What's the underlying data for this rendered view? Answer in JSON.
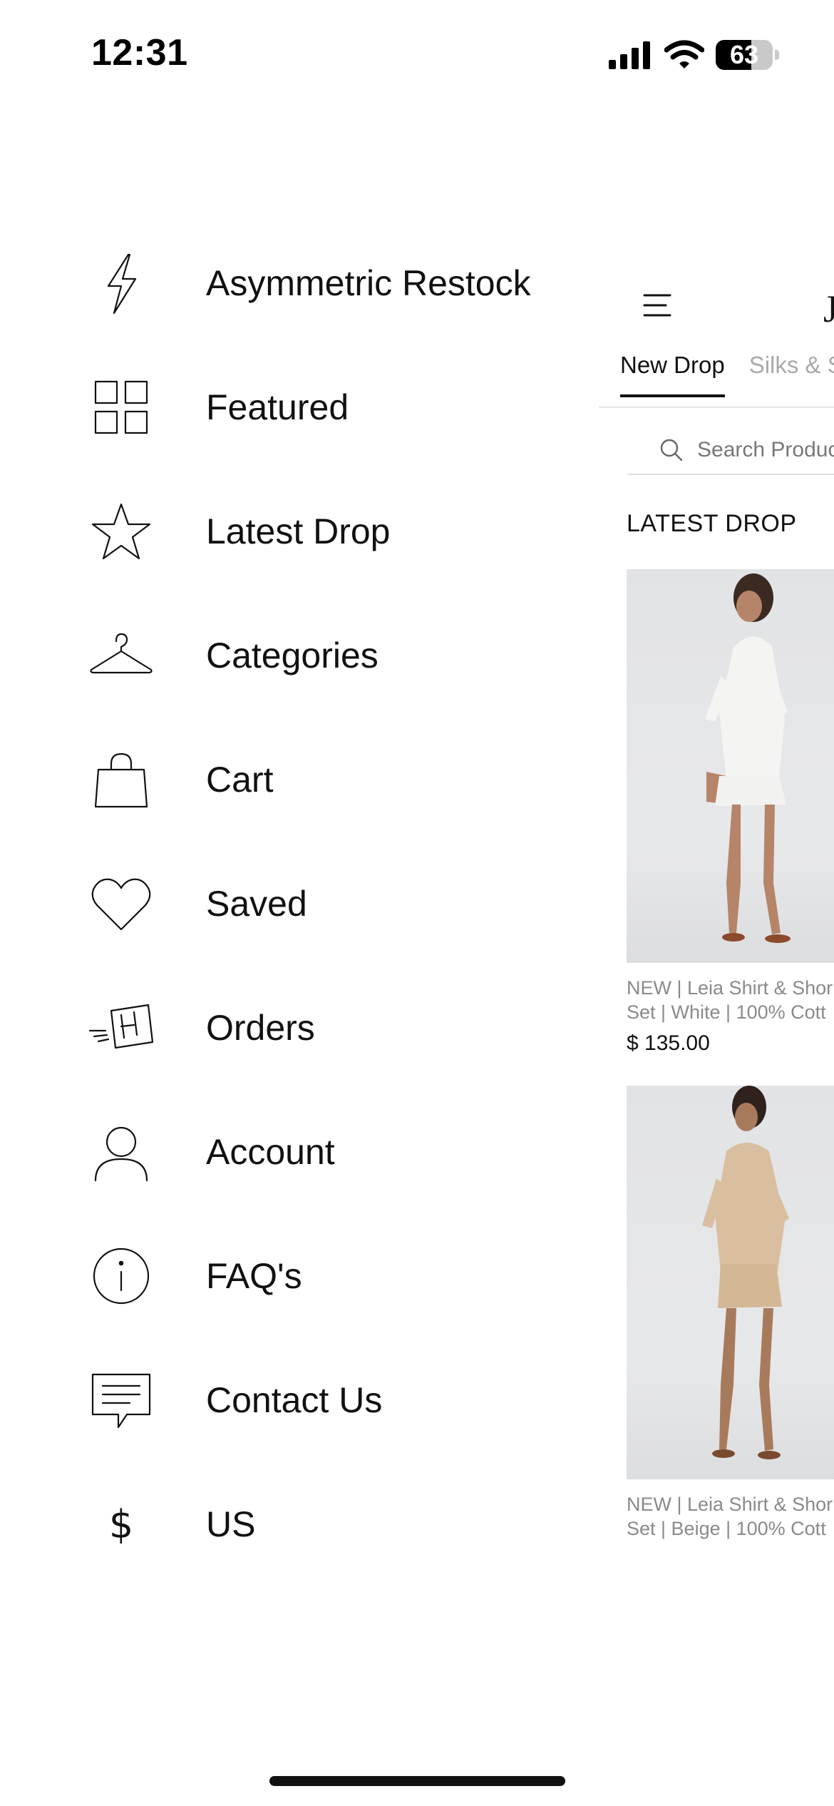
{
  "status_bar": {
    "time": "12:31",
    "battery_level": "63",
    "battery_fraction": 0.63
  },
  "menu": {
    "items": [
      {
        "label": "Asymmetric Restock",
        "icon": "lightning-icon"
      },
      {
        "label": "Featured",
        "icon": "grid-icon"
      },
      {
        "label": "Latest Drop",
        "icon": "star-icon"
      },
      {
        "label": "Categories",
        "icon": "hanger-icon"
      },
      {
        "label": "Cart",
        "icon": "shopping-bag-icon"
      },
      {
        "label": "Saved",
        "icon": "heart-icon"
      },
      {
        "label": "Orders",
        "icon": "delivery-box-icon"
      },
      {
        "label": "Account",
        "icon": "person-icon"
      },
      {
        "label": "FAQ's",
        "icon": "info-icon"
      },
      {
        "label": "Contact Us",
        "icon": "chat-icon"
      },
      {
        "label": "US",
        "icon": "dollar-icon",
        "symbol": "$"
      }
    ]
  },
  "store": {
    "brand_fragment": "J",
    "tabs": [
      {
        "label": "New Drop",
        "active": true
      },
      {
        "label": "Silks & S",
        "active": false
      }
    ],
    "search": {
      "placeholder": "Search Products"
    },
    "section_title": "LATEST DROP",
    "products": [
      {
        "name_line1": "NEW | Leia Shirt & Shor",
        "name_line2": "Set | White | 100% Cott",
        "price": "$ 135.00",
        "color": "white"
      },
      {
        "name_line1": "NEW | Leia Shirt & Shor",
        "name_line2": "Set | Beige | 100% Cott",
        "price": "",
        "color": "beige"
      }
    ]
  },
  "colors": {
    "text": "#111111",
    "muted": "#8a8a8a",
    "tab_inactive": "#a9a9a9",
    "background": "#ffffff"
  }
}
